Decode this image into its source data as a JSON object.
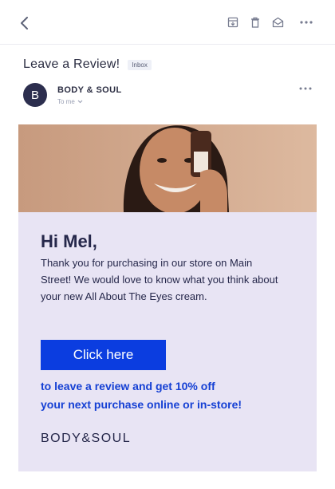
{
  "header": {
    "back_icon": "back-arrow-icon",
    "actions": [
      "archive-icon",
      "trash-icon",
      "mail-open-icon",
      "more-icon"
    ]
  },
  "message": {
    "subject": "Leave a Review!",
    "label": "Inbox",
    "sender_initial": "B",
    "sender_name": "BODY & SOUL",
    "recipient": "To me"
  },
  "email_body": {
    "greeting": "Hi Mel,",
    "paragraph": "Thank you for purchasing in our store on Main Street! We would love to know what you think about your new All About The Eyes cream.",
    "cta_label": "Click here",
    "promo_line_1": "to leave a review and get ",
    "promo_highlight": "10% off",
    "promo_line_2": "your next purchase online or in-store!",
    "brand_logo": "BODY&SOUL"
  },
  "colors": {
    "accent": "#0b3de0",
    "email_background": "#e8e4f4",
    "avatar": "#2c2e4e"
  }
}
